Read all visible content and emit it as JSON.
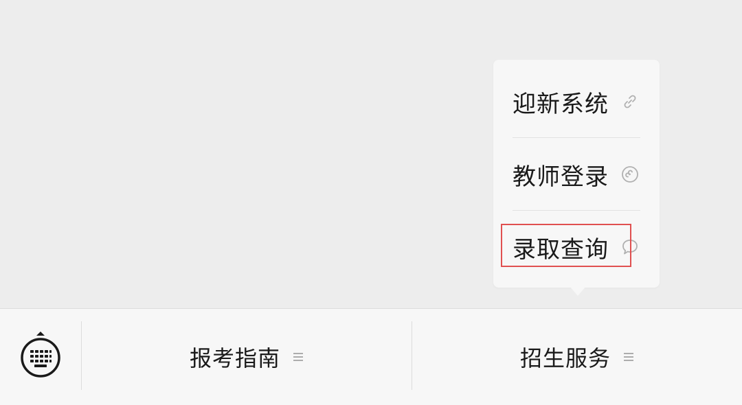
{
  "popup": {
    "items": [
      {
        "label": "迎新系统",
        "icon": "link-icon"
      },
      {
        "label": "教师登录",
        "icon": "mini-program-icon"
      },
      {
        "label": "录取查询",
        "icon": "chat-bubble-icon"
      }
    ]
  },
  "bottom_bar": {
    "keyboard_icon": "keyboard-icon",
    "menus": [
      {
        "label": "报考指南",
        "icon": "menu-lines-icon"
      },
      {
        "label": "招生服务",
        "icon": "menu-lines-icon"
      }
    ]
  },
  "colors": {
    "background": "#ededed",
    "popup_bg": "#f7f7f7",
    "highlight": "#e05050",
    "text": "#1a1a1a",
    "icon_gray": "#b0b0b0"
  }
}
